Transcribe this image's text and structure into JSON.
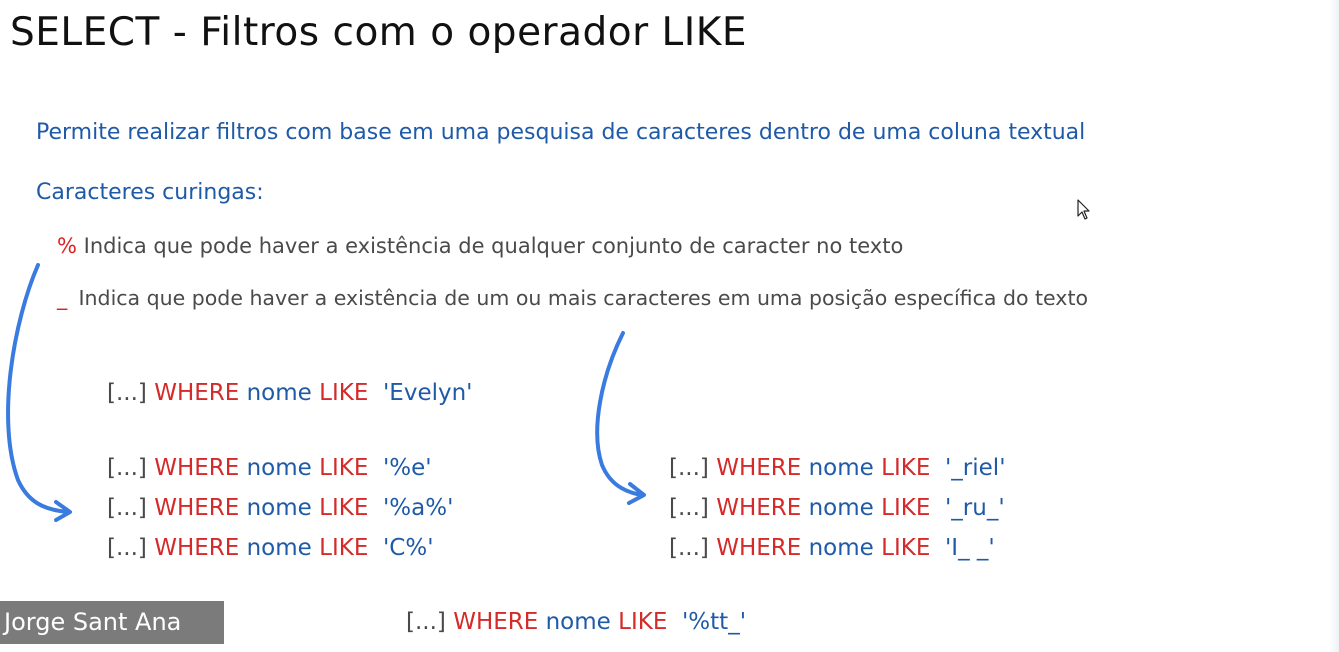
{
  "slide": {
    "title": "SELECT - Filtros com o operador LIKE",
    "description": "Permite realizar filtros com base em uma pesquisa de caracteres dentro de uma coluna textual",
    "wildcards_heading": "Caracteres curingas:",
    "wildcards": [
      {
        "symbol": "%",
        "text": " Indica que pode haver a existência de qualquer conjunto de caracter no texto"
      },
      {
        "symbol": "_",
        "text": " Indica que pode haver a existência de um ou mais caracteres em uma posição específica do texto"
      }
    ],
    "query_parts": {
      "bracket": "[...]",
      "where": "WHERE",
      "column": "nome",
      "like": "LIKE"
    },
    "queries": {
      "exact": "'Evelyn'",
      "left_column": [
        "'%e'",
        "'%a%'",
        "'C%'"
      ],
      "right_column": [
        "'_riel'",
        "'_ru_'",
        "'I_ _'"
      ],
      "bottom": "'%tt_'"
    },
    "colors": {
      "keyword": "#d42a2a",
      "text_blue": "#1f5aa8",
      "arrow": "#3a7be0",
      "wildcard_symbol": "#e02020"
    }
  },
  "presenter": {
    "name": "Jorge Sant Ana"
  },
  "icons": {
    "cursor": "mouse-pointer-icon",
    "arrows": "curved-arrow-icon"
  }
}
